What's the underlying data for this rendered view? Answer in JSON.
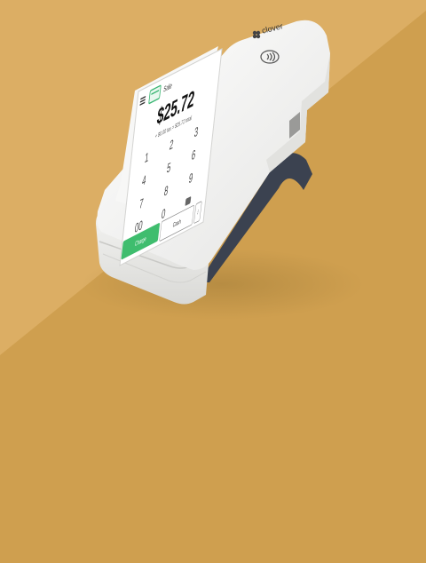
{
  "colors": {
    "background": "#cf9f4f",
    "background_light": "#dcae64",
    "device_body": "#f2f2f0",
    "screen_bg": "#ffffff",
    "accent_green": "#3fbd6e",
    "stand": "#3b4250"
  },
  "device": {
    "brand": "clover",
    "icons": [
      "clover-logo-icon",
      "contactless-icon",
      "menu-icon",
      "card-icon",
      "backspace-icon"
    ]
  },
  "screen": {
    "sale_label": "Sale",
    "amount": "$25.72",
    "tax_line": "+ $0.00 tax = $25.72 total",
    "keypad": [
      "1",
      "2",
      "3",
      "4",
      "5",
      "6",
      "7",
      "8",
      "9",
      "00",
      "0",
      ""
    ],
    "charge_label": "Charge",
    "cash_label": "Cash",
    "split_label": "⁝"
  }
}
